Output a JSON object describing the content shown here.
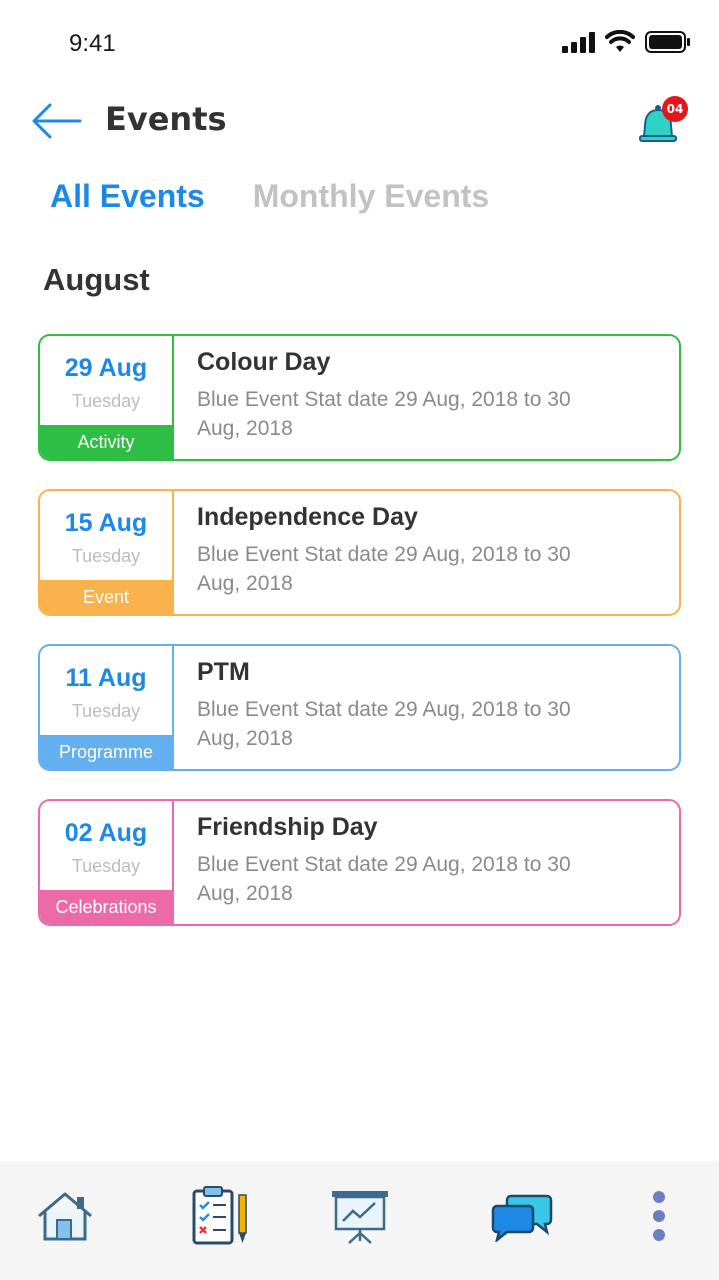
{
  "status_bar": {
    "time": "9:41"
  },
  "header": {
    "title": "Events",
    "notification_count": "04"
  },
  "tabs": [
    {
      "label": "All Events",
      "active": true
    },
    {
      "label": "Monthly Events",
      "active": false
    }
  ],
  "section": {
    "month": "August"
  },
  "events": [
    {
      "date": "29 Aug",
      "day": "Tuesday",
      "category": "Activity",
      "title": "Colour Day",
      "description": "Blue Event Stat date 29 Aug, 2018 to 30 Aug, 2018",
      "color": "#2ebd45"
    },
    {
      "date": "15 Aug",
      "day": "Tuesday",
      "category": "Event",
      "title": "Independence Day",
      "description": "Blue Event Stat date 29 Aug, 2018 to 30 Aug, 2018",
      "color": "#f9b24c"
    },
    {
      "date": "11 Aug",
      "day": "Tuesday",
      "category": "Programme",
      "title": "PTM",
      "description": "Blue Event Stat date 29 Aug, 2018 to 30 Aug, 2018",
      "color": "#64aff0"
    },
    {
      "date": "02 Aug",
      "day": "Tuesday",
      "category": "Celebrations",
      "title": "Friendship Day",
      "description": "Blue Event Stat date 29 Aug, 2018 to 30 Aug, 2018",
      "color": "#ec6aa7"
    }
  ],
  "bottom_nav": [
    {
      "icon": "home-icon"
    },
    {
      "icon": "clipboard-checklist-icon"
    },
    {
      "icon": "presentation-board-icon"
    },
    {
      "icon": "chat-bubbles-icon"
    },
    {
      "icon": "more-vertical-icon"
    }
  ],
  "colors": {
    "accent": "#1e88e5",
    "inactive_tab": "#c2c2c2",
    "badge": "#e5151e"
  }
}
